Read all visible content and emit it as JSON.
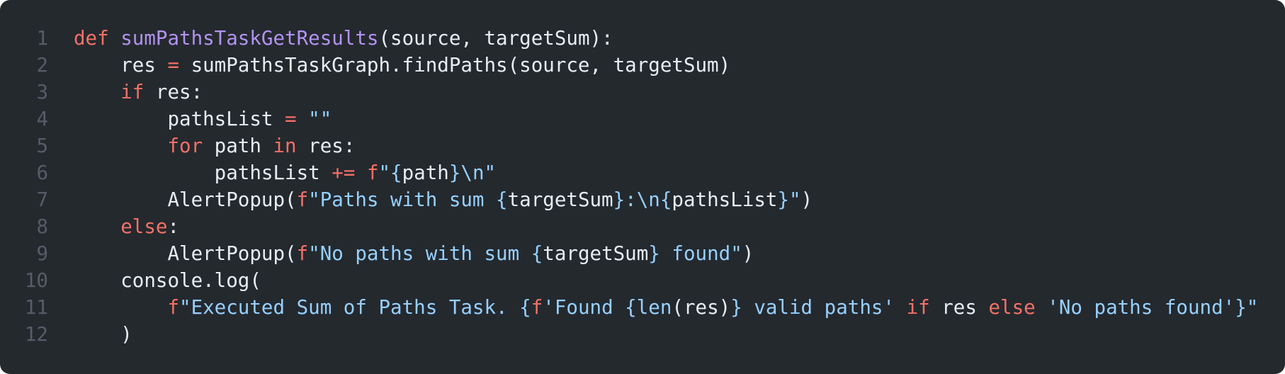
{
  "colors": {
    "background": "#24292e",
    "keyword": "#f47067",
    "function": "#b392f0",
    "string": "#96d0ff",
    "text": "#e6edf3",
    "line_number": "#545d68"
  },
  "code": {
    "lines": [
      {
        "number": "1",
        "tokens": [
          [
            "def ",
            "kw"
          ],
          [
            "sumPathsTaskGetResults",
            "fn"
          ],
          [
            "(source, targetSum):",
            "txt"
          ]
        ]
      },
      {
        "number": "2",
        "tokens": [
          [
            "    res ",
            "txt"
          ],
          [
            "=",
            "kw"
          ],
          [
            " sumPathsTaskGraph.findPaths(source, targetSum)",
            "txt"
          ]
        ]
      },
      {
        "number": "3",
        "tokens": [
          [
            "    ",
            "txt"
          ],
          [
            "if",
            "kw"
          ],
          [
            " res:",
            "txt"
          ]
        ]
      },
      {
        "number": "4",
        "tokens": [
          [
            "        pathsList ",
            "txt"
          ],
          [
            "=",
            "kw"
          ],
          [
            " ",
            "txt"
          ],
          [
            "\"\"",
            "str"
          ]
        ]
      },
      {
        "number": "5",
        "tokens": [
          [
            "        ",
            "txt"
          ],
          [
            "for",
            "kw"
          ],
          [
            " path ",
            "txt"
          ],
          [
            "in",
            "kw"
          ],
          [
            " res:",
            "txt"
          ]
        ]
      },
      {
        "number": "6",
        "tokens": [
          [
            "            pathsList ",
            "txt"
          ],
          [
            "+=",
            "kw"
          ],
          [
            " ",
            "txt"
          ],
          [
            "f",
            "kw"
          ],
          [
            "\"{",
            "str"
          ],
          [
            "path",
            "txt"
          ],
          [
            "}\\n\"",
            "str"
          ]
        ]
      },
      {
        "number": "7",
        "tokens": [
          [
            "        AlertPopup(",
            "txt"
          ],
          [
            "f",
            "kw"
          ],
          [
            "\"Paths with sum {",
            "str"
          ],
          [
            "targetSum",
            "txt"
          ],
          [
            "}:\\n{",
            "str"
          ],
          [
            "pathsList",
            "txt"
          ],
          [
            "}\"",
            "str"
          ],
          [
            ")",
            "txt"
          ]
        ]
      },
      {
        "number": "8",
        "tokens": [
          [
            "    ",
            "txt"
          ],
          [
            "else",
            "kw"
          ],
          [
            ":",
            "txt"
          ]
        ]
      },
      {
        "number": "9",
        "tokens": [
          [
            "        AlertPopup(",
            "txt"
          ],
          [
            "f",
            "kw"
          ],
          [
            "\"No paths with sum {",
            "str"
          ],
          [
            "targetSum",
            "txt"
          ],
          [
            "} found\"",
            "str"
          ],
          [
            ")",
            "txt"
          ]
        ]
      },
      {
        "number": "10",
        "tokens": [
          [
            "    console.log(",
            "txt"
          ]
        ]
      },
      {
        "number": "11",
        "tokens": [
          [
            "        ",
            "txt"
          ],
          [
            "f",
            "kw"
          ],
          [
            "\"Executed Sum of Paths Task. {",
            "str"
          ],
          [
            "f",
            "kw"
          ],
          [
            "'Found {",
            "str"
          ],
          [
            "len",
            "str"
          ],
          [
            "(res)",
            "txt"
          ],
          [
            "} valid paths'",
            "str"
          ],
          [
            " ",
            "txt"
          ],
          [
            "if",
            "kw"
          ],
          [
            " res ",
            "txt"
          ],
          [
            "else",
            "kw"
          ],
          [
            " ",
            "txt"
          ],
          [
            "'No paths found'",
            "str"
          ],
          [
            "}\"",
            "str"
          ]
        ]
      },
      {
        "number": "12",
        "tokens": [
          [
            "    )",
            "txt"
          ]
        ]
      }
    ]
  }
}
